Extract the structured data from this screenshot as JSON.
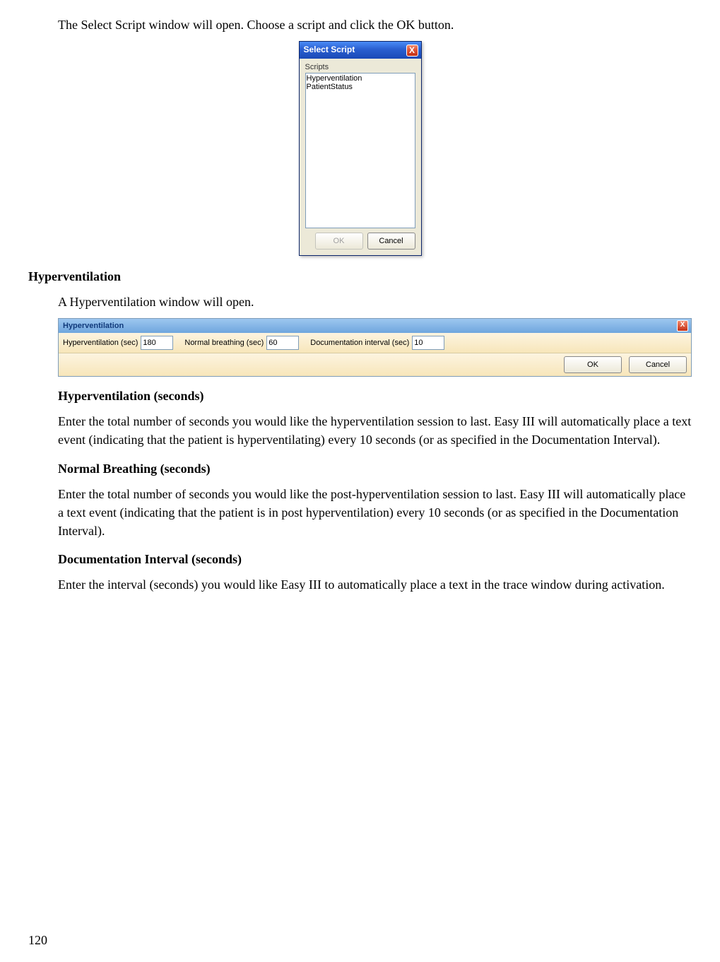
{
  "intro": "The Select Script window will open. Choose a script and click the OK button.",
  "select_script": {
    "title": "Select Script",
    "close": "X",
    "group_label": "Scripts",
    "items": [
      "Hyperventilation",
      "PatientStatus"
    ],
    "ok": "OK",
    "cancel": "Cancel"
  },
  "section_title": "Hyperventilation",
  "open_text": "A Hyperventilation window will open.",
  "hv_bar": {
    "title": "Hyperventilation",
    "close": "X",
    "hv_label": "Hyperventilation (sec)",
    "hv_val": "180",
    "nb_label": "Normal breathing (sec)",
    "nb_val": "60",
    "di_label": "Documentation interval (sec)",
    "di_val": "10",
    "ok": "OK",
    "cancel": "Cancel"
  },
  "hv_heading": "Hyperventilation (seconds)",
  "hv_body": "Enter the total number of seconds you would like the hyperventilation session to last.  Easy III will automatically place a text event (indicating that the patient is hyperventilating) every 10 seconds (or as specified in the Documentation Interval).",
  "nb_heading": "Normal Breathing (seconds)",
  "nb_body": "Enter the total number of seconds you would like the post-hyperventilation session to last.  Easy III will automatically place a text event (indicating that the patient is in post hyperventilation) every 10 seconds (or as specified in the Documentation Interval).",
  "di_heading": "Documentation Interval (seconds)",
  "di_body": "Enter the interval (seconds) you would like Easy III to automatically place a text in the trace window during activation.",
  "page_number": "120"
}
